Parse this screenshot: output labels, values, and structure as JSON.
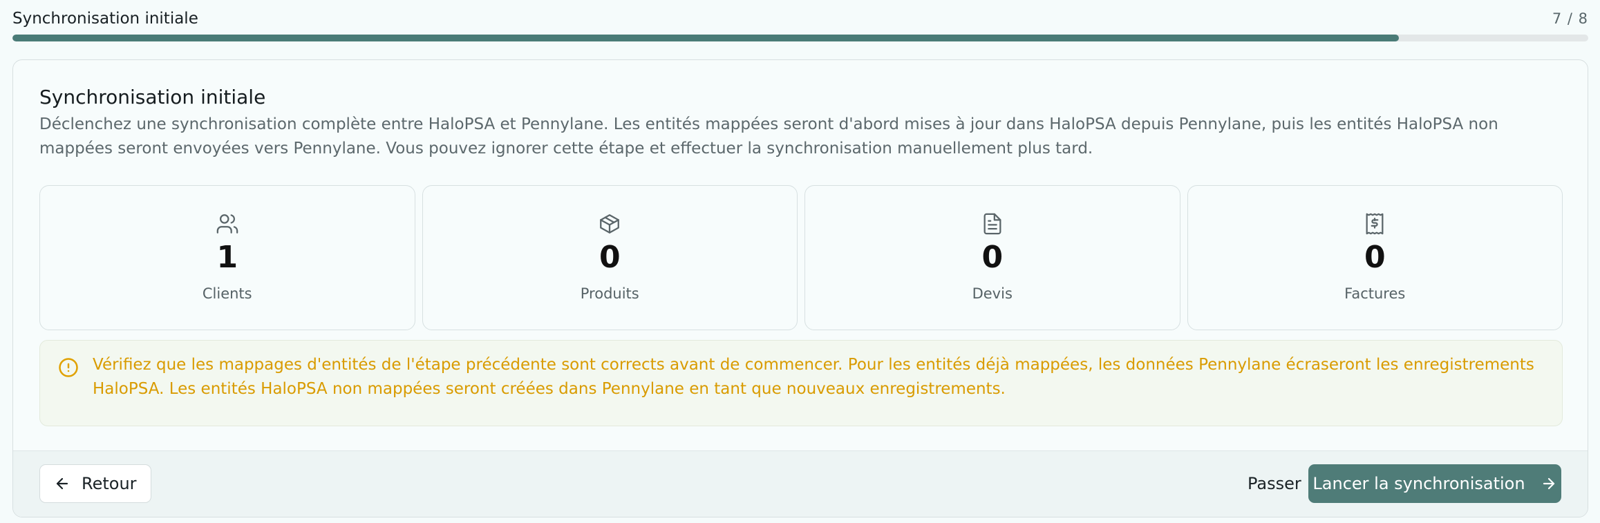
{
  "header": {
    "title": "Synchronisation initiale",
    "step": "7 / 8",
    "progress": 0.88
  },
  "card": {
    "title": "Synchronisation initiale",
    "description": "Déclenchez une synchronisation complète entre HaloPSA et Pennylane. Les entités mappées seront d'abord mises à jour dans HaloPSA depuis Pennylane, puis les entités HaloPSA non mappées seront envoyées vers Pennylane. Vous pouvez ignorer cette étape et effectuer la synchronisation manuellement plus tard."
  },
  "stats": [
    {
      "icon": "users-icon",
      "value": "1",
      "label": "Clients"
    },
    {
      "icon": "package-icon",
      "value": "0",
      "label": "Produits"
    },
    {
      "icon": "file-text-icon",
      "value": "0",
      "label": "Devis"
    },
    {
      "icon": "receipt-icon",
      "value": "0",
      "label": "Factures"
    }
  ],
  "alert": {
    "icon": "alert-circle-icon",
    "text": "Vérifiez que les mappages d'entités de l'étape précédente sont corrects avant de commencer. Pour les entités déjà mappées, les données Pennylane écraseront les enregistrements HaloPSA. Les entités HaloPSA non mappées seront créées dans Pennylane en tant que nouveaux enregistrements."
  },
  "footer": {
    "back_label": "Retour",
    "skip_label": "Passer",
    "launch_label": "Lancer la synchronisation"
  },
  "colors": {
    "accent": "#4f7c78",
    "warning": "#d99b00",
    "background": "#f5fbfb"
  }
}
